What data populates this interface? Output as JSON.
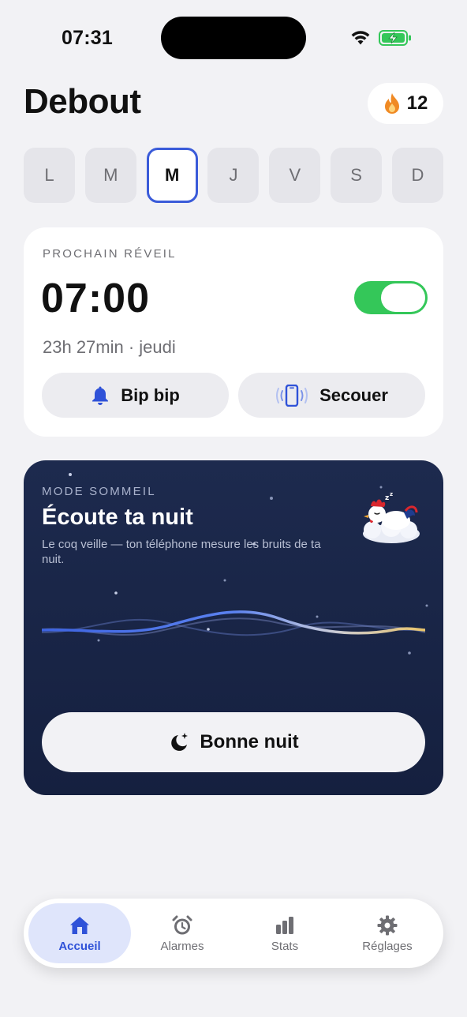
{
  "status_bar": {
    "time": "07:31"
  },
  "header": {
    "title": "Debout",
    "streak_count": "12"
  },
  "days": [
    "L",
    "M",
    "M",
    "J",
    "V",
    "S",
    "D"
  ],
  "selected_day": "M",
  "next_alarm": {
    "label": "PROCHAIN RÉVEIL",
    "time": "07:00",
    "enabled": true,
    "countdown": "23h 27min · jeudi",
    "sound_button": "Bip bip",
    "dismiss_button": "Secouer"
  },
  "sleep_mode": {
    "label": "MODE SOMMEIL",
    "title": "Écoute ta nuit",
    "description": "Le coq veille — ton téléphone mesure les bruits de ta nuit.",
    "button": "Bonne nuit"
  },
  "tabs": [
    {
      "label": "Accueil",
      "icon": "home-icon",
      "active": true
    },
    {
      "label": "Alarmes",
      "icon": "alarm-clock-icon",
      "active": false
    },
    {
      "label": "Stats",
      "icon": "bar-chart-icon",
      "active": false
    },
    {
      "label": "Réglages",
      "icon": "gear-icon",
      "active": false
    }
  ],
  "colors": {
    "accent": "#3a5bd9",
    "toggle_on": "#34c759",
    "night_card": "#1d2a4e",
    "flame": "#f08a24"
  }
}
